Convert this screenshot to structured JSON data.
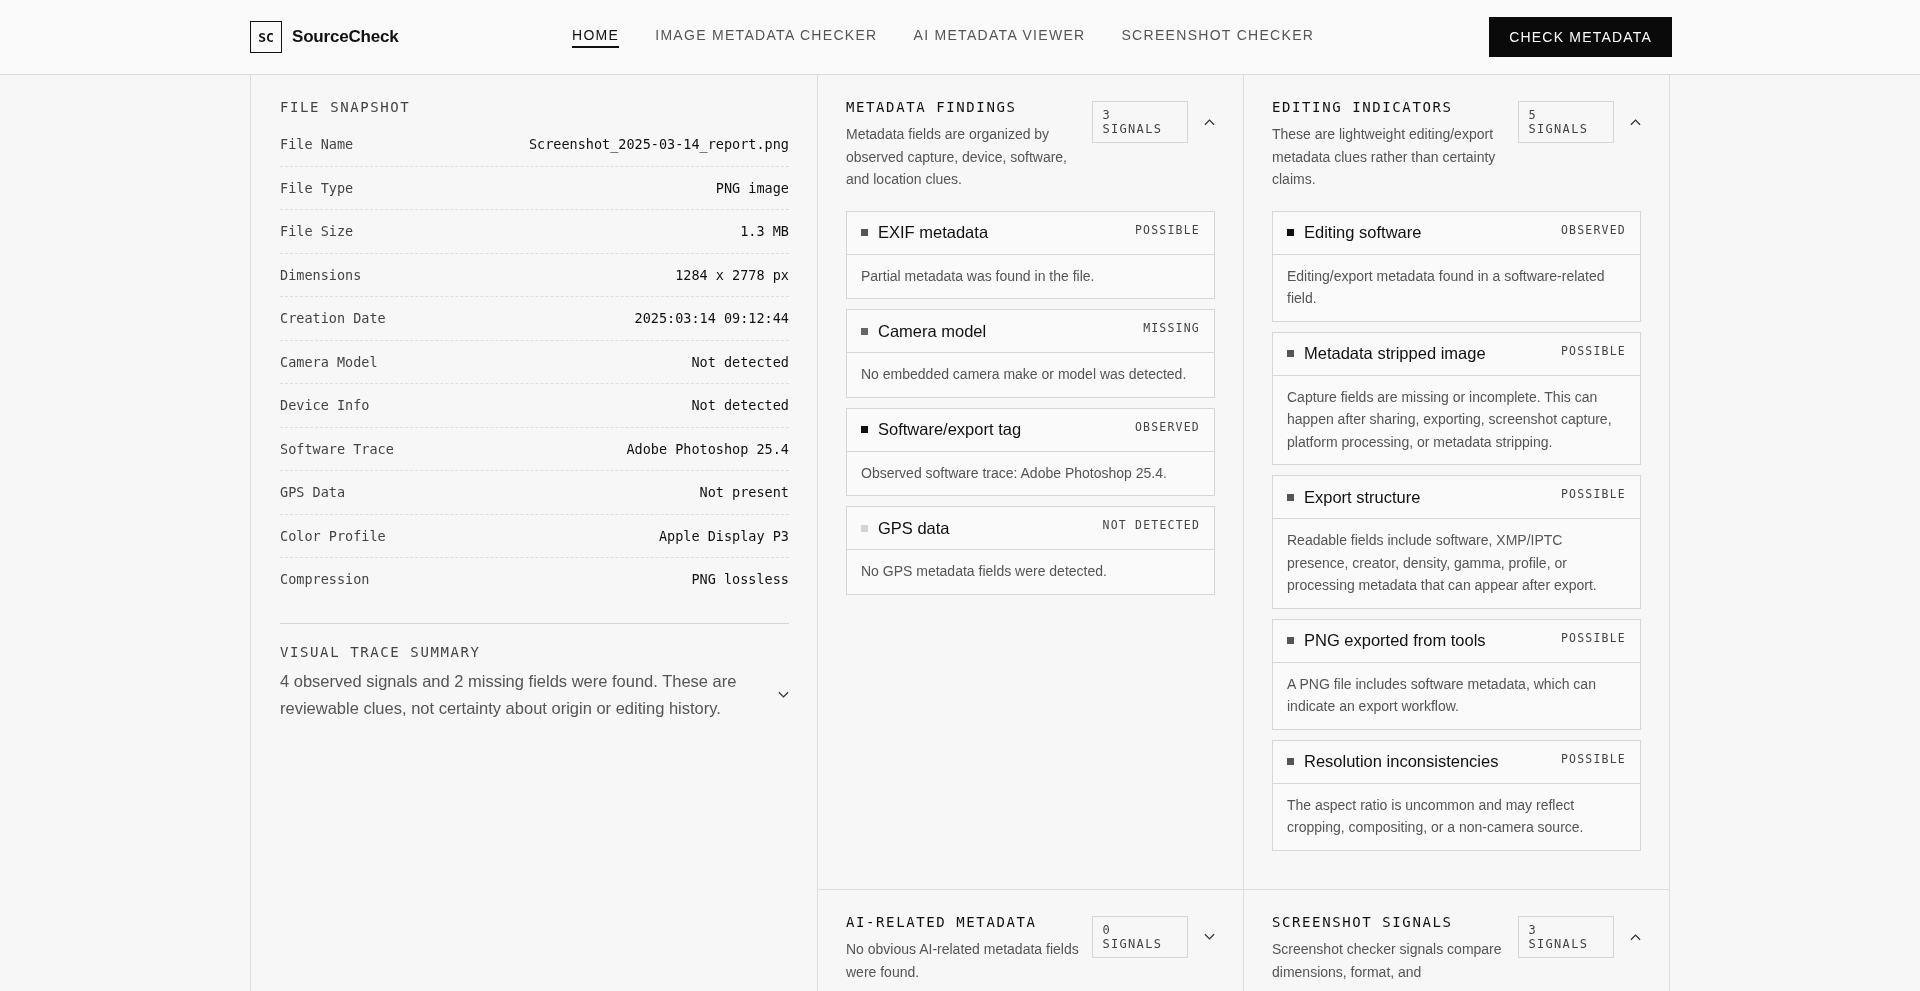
{
  "brand": {
    "logo": "SC",
    "name": "SourceCheck"
  },
  "nav": [
    {
      "label": "HOME",
      "selected": true
    },
    {
      "label": "IMAGE METADATA CHECKER",
      "selected": false
    },
    {
      "label": "AI METADATA VIEWER",
      "selected": false
    },
    {
      "label": "SCREENSHOT CHECKER",
      "selected": false
    }
  ],
  "cta": "CHECK METADATA",
  "file_snapshot": {
    "title": "FILE SNAPSHOT",
    "rows": [
      {
        "label": "File Name",
        "value": "Screenshot_2025-03-14_report.png"
      },
      {
        "label": "File Type",
        "value": "PNG image"
      },
      {
        "label": "File Size",
        "value": "1.3 MB"
      },
      {
        "label": "Dimensions",
        "value": "1284 x 2778 px"
      },
      {
        "label": "Creation Date",
        "value": "2025:03:14 09:12:44"
      },
      {
        "label": "Camera Model",
        "value": "Not detected"
      },
      {
        "label": "Device Info",
        "value": "Not detected"
      },
      {
        "label": "Software Trace",
        "value": "Adobe Photoshop 25.4"
      },
      {
        "label": "GPS Data",
        "value": "Not present"
      },
      {
        "label": "Color Profile",
        "value": "Apple Display P3"
      },
      {
        "label": "Compression",
        "value": "PNG lossless"
      }
    ]
  },
  "summary": {
    "title": "VISUAL TRACE SUMMARY",
    "text": "4 observed signals and 2 missing fields were found. These are reviewable clues, not certainty about origin or editing history.",
    "expanded": false
  },
  "sections": [
    {
      "title": "METADATA FINDINGS",
      "badge": "3 SIGNALS",
      "expanded": true,
      "description": "Metadata fields are organized by observed capture, device, software, and location clues.",
      "findings": [
        {
          "title": "EXIF metadata",
          "status": "POSSIBLE",
          "kind": "possible",
          "text": "Partial metadata was found in the file."
        },
        {
          "title": "Camera model",
          "status": "MISSING",
          "kind": "missing",
          "text": "No embedded camera make or model was detected."
        },
        {
          "title": "Software/export tag",
          "status": "OBSERVED",
          "kind": "observed",
          "text": "Observed software trace: Adobe Photoshop 25.4."
        },
        {
          "title": "GPS data",
          "status": "NOT DETECTED",
          "kind": "absent",
          "text": "No GPS metadata fields were detected."
        }
      ]
    },
    {
      "title": "EDITING INDICATORS",
      "badge": "5 SIGNALS",
      "expanded": true,
      "description": "These are lightweight editing/export metadata clues rather than certainty claims.",
      "findings": [
        {
          "title": "Editing software",
          "status": "OBSERVED",
          "kind": "observed",
          "text": "Editing/export metadata found in a software-related field."
        },
        {
          "title": "Metadata stripped image",
          "status": "POSSIBLE",
          "kind": "possible",
          "text": "Capture fields are missing or incomplete. This can happen after sharing, exporting, screenshot capture, platform processing, or metadata stripping."
        },
        {
          "title": "Export structure",
          "status": "POSSIBLE",
          "kind": "possible",
          "text": "Readable fields include software, XMP/IPTC presence, creator, density, gamma, profile, or processing metadata that can appear after export."
        },
        {
          "title": "PNG exported from tools",
          "status": "POSSIBLE",
          "kind": "possible",
          "text": "A PNG file includes software metadata, which can indicate an export workflow."
        },
        {
          "title": "Resolution inconsistencies",
          "status": "POSSIBLE",
          "kind": "possible",
          "text": "The aspect ratio is uncommon and may reflect cropping, compositing, or a non-camera source."
        }
      ]
    },
    {
      "title": "AI-RELATED METADATA",
      "badge": "0 SIGNALS",
      "expanded": false,
      "description": "No obvious AI-related metadata fields were found."
    },
    {
      "title": "SCREENSHOT SIGNALS",
      "badge": "3 SIGNALS",
      "expanded": true,
      "description": "Screenshot checker signals compare dimensions, format, and"
    }
  ]
}
